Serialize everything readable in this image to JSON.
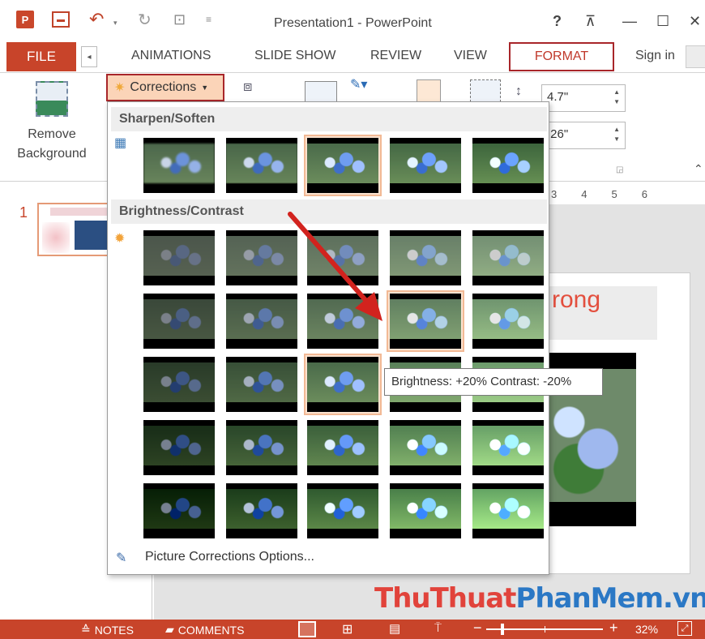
{
  "titlebar": {
    "app_icon": "P",
    "window_title": "Presentation1 - PowerPoint",
    "help": "?",
    "min": "—",
    "max": "☐",
    "close": "✕"
  },
  "tabs": {
    "file": "FILE",
    "animations": "ANIMATIONS",
    "slideshow": "SLIDE SHOW",
    "review": "REVIEW",
    "view": "VIEW",
    "format": "FORMAT",
    "signin": "Sign in"
  },
  "ribbon": {
    "remove_bg_line1": "Remove",
    "remove_bg_line2": "Background",
    "corrections_label": "Corrections",
    "height_value": "4.7\"",
    "width_value": ".26\""
  },
  "gallery": {
    "sharpen_header": "Sharpen/Soften",
    "brightness_header": "Brightness/Contrast",
    "options_label": "Picture Corrections Options..."
  },
  "tooltip": "Brightness: +20% Contrast: -20%",
  "slides": {
    "number": "1",
    "title_fragment": "rong"
  },
  "ruler": [
    "3",
    "4",
    "5",
    "6"
  ],
  "watermark": {
    "part1": "ThuThuat",
    "part2": "PhanMem.vn"
  },
  "status": {
    "notes": "NOTES",
    "comments": "COMMENTS",
    "zoom": "32%"
  },
  "colors": {
    "accent": "#c8442a",
    "highlight_border": "#a8262a",
    "selection_fill": "#fbe2cf"
  },
  "icons": [
    "app-icon",
    "save-icon",
    "undo-icon",
    "redo-icon",
    "present-icon",
    "crop-icon",
    "sharpen-icon",
    "sun-icon",
    "options-icon",
    "notes-icon",
    "comments-icon"
  ]
}
